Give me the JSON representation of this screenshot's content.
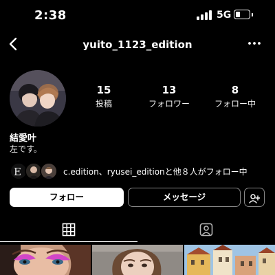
{
  "status_bar": {
    "time": "2:38",
    "network": "5G",
    "battery_level": 0.35,
    "icons": [
      "cellular-signal-icon",
      "battery-icon"
    ]
  },
  "nav": {
    "username": "yuito_1123_edition",
    "icons": [
      "chevron-left-icon",
      "more-horizontal-icon"
    ]
  },
  "profile": {
    "display_name": "結愛叶",
    "bio": "左です。",
    "stats": [
      {
        "value": "15",
        "label": "投稿"
      },
      {
        "value": "13",
        "label": "フォロワー"
      },
      {
        "value": "8",
        "label": "フォロー中"
      }
    ]
  },
  "followed_by": {
    "text": "c.edition、ryusei_editionと他８人がフォロー中"
  },
  "actions": {
    "follow": "フォロー",
    "message": "メッセージ",
    "add_user_icon": "add-user-icon"
  },
  "tabs": [
    {
      "icon": "grid-icon",
      "active": true
    },
    {
      "icon": "tagged-person-icon",
      "active": false
    }
  ],
  "colors": {
    "background": "#000000",
    "text": "#ffffff",
    "button_outline": "#8a8a8a"
  }
}
